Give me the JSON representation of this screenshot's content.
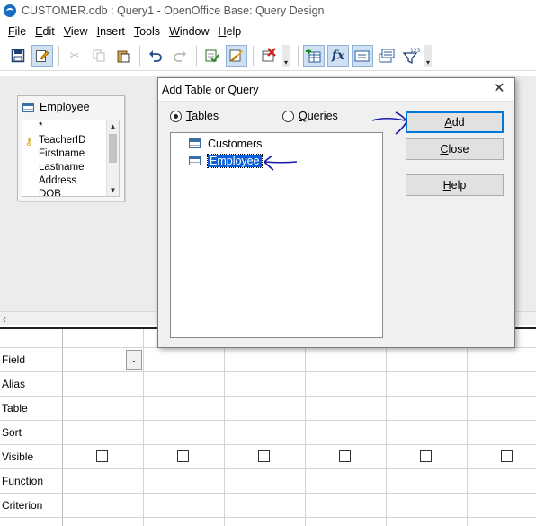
{
  "window": {
    "title": "CUSTOMER.odb : Query1 - OpenOffice Base: Query Design"
  },
  "menu": [
    {
      "u": "F",
      "rest": "ile"
    },
    {
      "u": "E",
      "rest": "dit"
    },
    {
      "u": "V",
      "rest": "iew"
    },
    {
      "u": "I",
      "rest": "nsert"
    },
    {
      "u": "T",
      "rest": "ools"
    },
    {
      "u": "W",
      "rest": "indow"
    },
    {
      "u": "H",
      "rest": "elp"
    }
  ],
  "toolbar": {
    "buttons": [
      "save-icon",
      "edit-icon",
      "cut-icon",
      "copy-icon",
      "paste-icon",
      "undo-icon",
      "redo-icon",
      "run-query-icon",
      "design-view-icon",
      "clear-query-icon",
      "add-tables-icon",
      "functions-icon",
      "table-name-icon",
      "alias-icon",
      "distinct-values-icon"
    ],
    "functions_glyph": "fx",
    "distinct_glyph": "123"
  },
  "tablebox": {
    "name": "Employee",
    "fields": [
      "*",
      "TeacherID",
      "Firstname",
      "Lastname",
      "Address",
      "DOB"
    ],
    "key_field": "TeacherID"
  },
  "grid": {
    "rows": [
      "Field",
      "Alias",
      "Table",
      "Sort",
      "Visible",
      "Function",
      "Criterion"
    ]
  },
  "dialog": {
    "title": "Add Table or Query",
    "radio_tables": {
      "u": "T",
      "rest": "ables",
      "checked": true
    },
    "radio_queries": {
      "u": "Q",
      "rest": "ueries",
      "checked": false
    },
    "items": [
      {
        "label": "Customers",
        "selected": false
      },
      {
        "label": "Employee",
        "selected": true
      }
    ],
    "buttons": {
      "add": {
        "u": "A",
        "rest": "dd"
      },
      "close": {
        "u": "C",
        "rest": "lose"
      },
      "help": {
        "u": "H",
        "rest": "elp"
      }
    }
  },
  "annotation_color": "#1a1aa8"
}
